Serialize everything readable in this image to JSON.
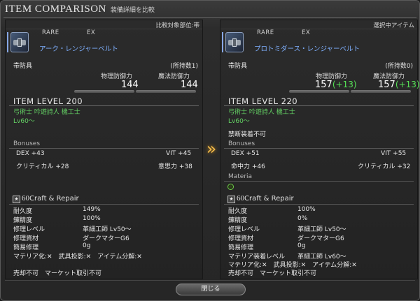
{
  "window": {
    "title": "ITEM COMPARISON",
    "subtitle": "装備詳細を比較",
    "arrow_glyph": "»",
    "close_label": "閉じる"
  },
  "left": {
    "header": "比較対象部位:帯",
    "rarity": "RARE",
    "ex": "EX",
    "name": "アーク・レンジャーベルト",
    "slot": "帯防具",
    "owned": "(所持数1)",
    "phys_label": "物理防御力",
    "mag_label": "魔法防御力",
    "phys_val": "144",
    "mag_val": "144",
    "item_level": "ITEM LEVEL 200",
    "classes": "弓術士 吟遊詩人 機工士",
    "level": "Lv60～",
    "bonuses_title": "Bonuses",
    "bonuses": [
      {
        "label": "DEX +43"
      },
      {
        "label": "VIT +45"
      },
      {
        "label": "クリティカル +28"
      },
      {
        "label": "意思力 +38"
      }
    ],
    "cr_num": "60",
    "cr_label": "Craft & Repair",
    "rows": [
      {
        "label": "耐久度",
        "value": "149%"
      },
      {
        "label": "錬精度",
        "value": "100%"
      },
      {
        "label": "修理レベル",
        "value": "革細工師 Lv50～"
      },
      {
        "label": "修理資材",
        "value": "ダークマターG6"
      },
      {
        "label": "簡易修理",
        "value": "0g"
      }
    ],
    "flags": "マテリア化:✕　武具投影:✕　アイテム分解:✕",
    "trade": "売却不可　マーケット取引不可"
  },
  "right": {
    "header": "選択中アイテム",
    "rarity": "RARE",
    "ex": "EX",
    "name": "プロトミダース・レンジャーベルト",
    "slot": "帯防具",
    "owned": "(所持数0)",
    "phys_label": "物理防御力",
    "mag_label": "魔法防御力",
    "phys_val": "157",
    "phys_bonus": "(+13)",
    "mag_val": "157",
    "mag_bonus": "(+13)",
    "item_level": "ITEM LEVEL 220",
    "classes": "弓術士 吟遊詩人 機工士",
    "level": "Lv60～",
    "note": "禁断装着不可",
    "bonuses_title": "Bonuses",
    "bonuses": [
      {
        "label": "DEX +51"
      },
      {
        "label": "VIT +55"
      },
      {
        "label": "命中力 +46"
      },
      {
        "label": "クリティカル +32"
      }
    ],
    "materia_title": "Materia",
    "cr_num": "60",
    "cr_label": "Craft & Repair",
    "rows": [
      {
        "label": "耐久度",
        "value": "100%"
      },
      {
        "label": "錬精度",
        "value": "0%"
      },
      {
        "label": "修理レベル",
        "value": "革細工師 Lv50～"
      },
      {
        "label": "修理資材",
        "value": "ダークマターG6"
      },
      {
        "label": "簡易修理",
        "value": "0g"
      },
      {
        "label": "マテリア装着レベル",
        "value": "革細工師 Lv60～"
      }
    ],
    "flags": "マテリア化:✕　武具投影:✕　アイテム分解:✕",
    "trade": "売却不可　マーケット取引不可"
  }
}
